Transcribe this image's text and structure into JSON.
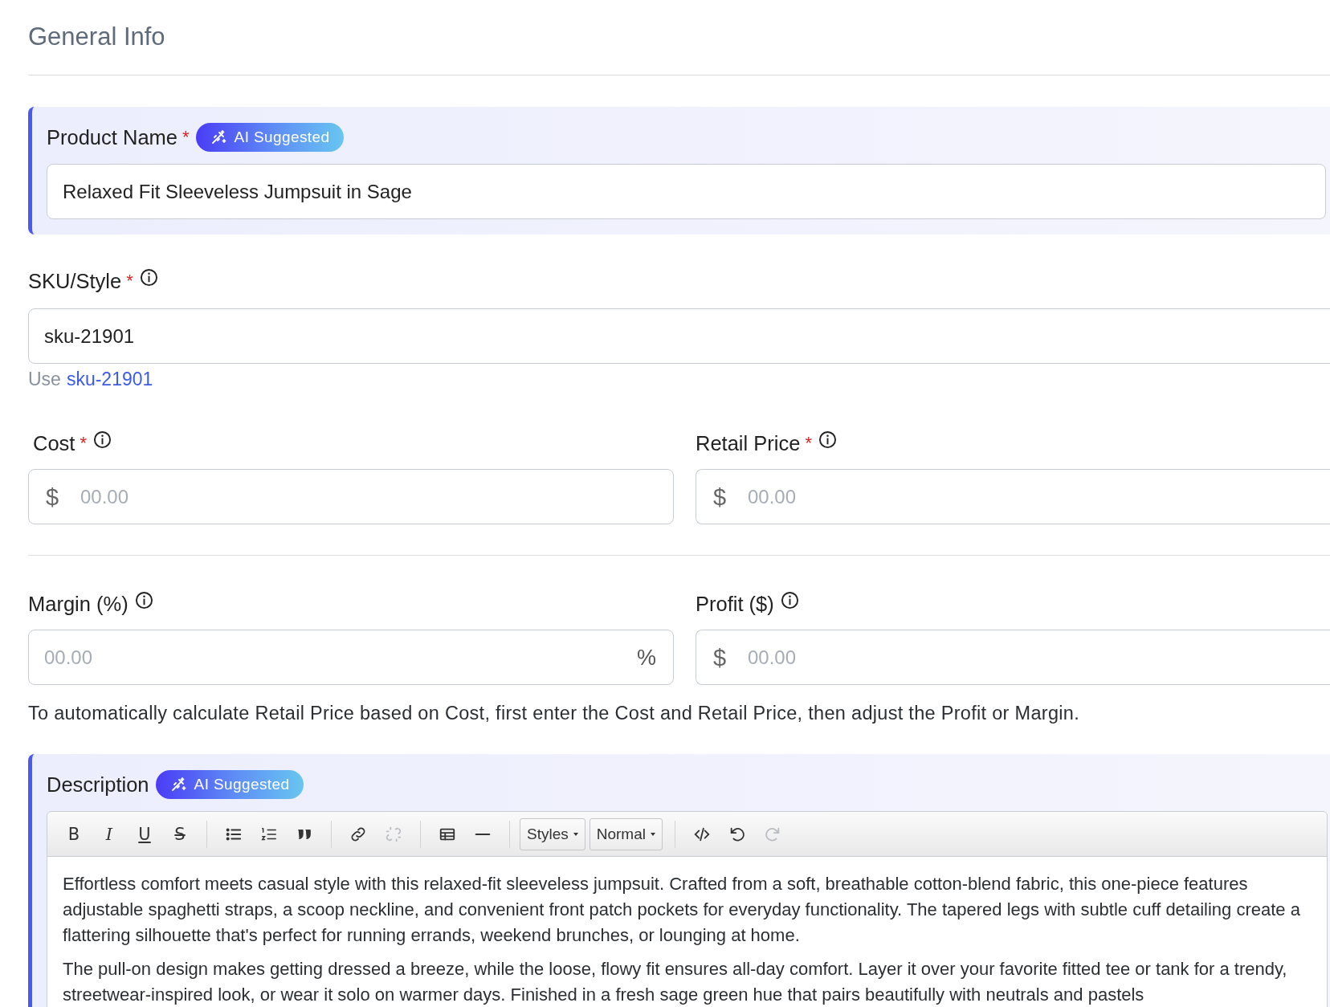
{
  "section_title": "General Info",
  "product_name": {
    "label": "Product Name",
    "required_mark": "*",
    "badge": "AI Suggested",
    "value": "Relaxed Fit Sleeveless Jumpsuit in Sage"
  },
  "sku": {
    "label": "SKU/Style",
    "required_mark": "*",
    "value": "sku-21901",
    "suggestion_prefix": "Use",
    "suggestion_link": "sku-21901"
  },
  "price_fields": [
    {
      "label": "Cost",
      "required_mark": "*",
      "prefix": "$",
      "placeholder": "00.00"
    },
    {
      "label": "Retail Price",
      "required_mark": "*",
      "prefix": "$",
      "placeholder": "00.00"
    }
  ],
  "calc_fields": [
    {
      "label": "Margin (%)",
      "suffix": "%",
      "placeholder": "00.00"
    },
    {
      "label": "Profit ($)",
      "prefix": "$",
      "placeholder": "00.00"
    }
  ],
  "help_text": "To automatically calculate Retail Price based on Cost, first enter the Cost and Retail Price, then adjust the Profit or Margin.",
  "description": {
    "label": "Description",
    "badge": "AI Suggested",
    "toolbar": [
      [
        {
          "kind": "text",
          "label": "B",
          "disabled": false
        },
        {
          "kind": "text",
          "label": "I",
          "disabled": false
        },
        {
          "kind": "text",
          "label": "U",
          "disabled": false
        },
        {
          "kind": "text",
          "label": "S",
          "disabled": false
        }
      ],
      [
        {
          "kind": "icon",
          "disabled": false
        },
        {
          "kind": "icon",
          "disabled": false
        },
        {
          "kind": "icon",
          "disabled": false
        }
      ],
      [
        {
          "kind": "icon",
          "disabled": false
        },
        {
          "kind": "icon",
          "disabled": true
        }
      ],
      [
        {
          "kind": "icon",
          "disabled": false
        },
        {
          "kind": "icon",
          "disabled": false
        }
      ],
      [
        {
          "kind": "select",
          "label": "Styles"
        },
        {
          "kind": "select",
          "label": "Normal"
        }
      ],
      [
        {
          "kind": "icon",
          "disabled": false
        },
        {
          "kind": "icon",
          "disabled": false
        },
        {
          "kind": "icon",
          "disabled": true
        }
      ]
    ],
    "paragraphs": [
      "Effortless comfort meets casual style with this relaxed-fit sleeveless jumpsuit. Crafted from a soft, breathable cotton-blend fabric, this one-piece features adjustable spaghetti straps, a scoop neckline, and convenient front patch pockets for everyday functionality. The tapered legs with subtle cuff detailing create a flattering silhouette that's perfect for running errands, weekend brunches, or lounging at home.",
      "The pull-on design makes getting dressed a breeze, while the loose, flowy fit ensures all-day comfort. Layer it over your favorite fitted tee or tank for a trendy, streetwear-inspired look, or wear it solo on warmer days. Finished in a fresh sage green hue that pairs beautifully with neutrals and pastels"
    ]
  }
}
